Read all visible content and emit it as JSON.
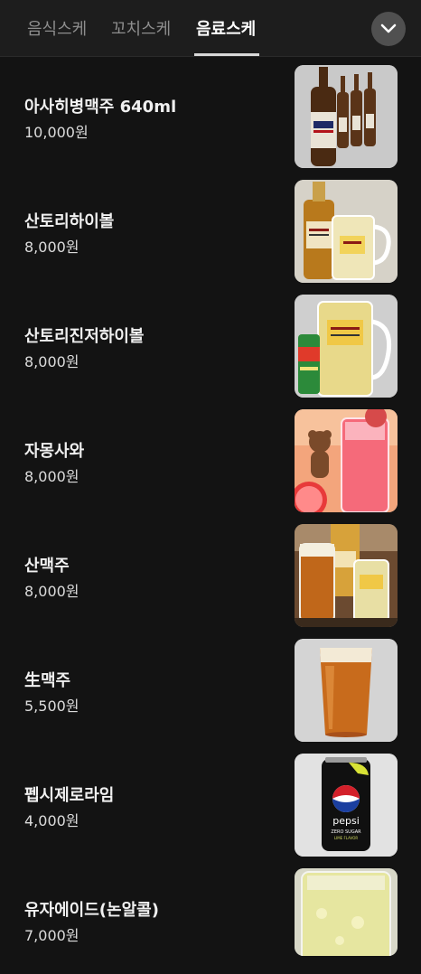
{
  "tabs": [
    {
      "label": "음식스케",
      "active": false
    },
    {
      "label": "꼬치스케",
      "active": false
    },
    {
      "label": "음료스케",
      "active": true
    }
  ],
  "expand_icon": "chevron-down-icon",
  "items": [
    {
      "name": "아사히병맥주 640ml",
      "price": "10,000원",
      "image": "asahi-bottles"
    },
    {
      "name": "산토리하이볼",
      "price": "8,000원",
      "image": "whisky-highball"
    },
    {
      "name": "산토리진저하이볼",
      "price": "8,000원",
      "image": "ginger-highball"
    },
    {
      "name": "자몽사와",
      "price": "8,000원",
      "image": "grapefruit-sour"
    },
    {
      "name": "산맥주",
      "price": "8,000원",
      "image": "beer-and-highball"
    },
    {
      "name": "生맥주",
      "price": "5,500원",
      "image": "draft-beer"
    },
    {
      "name": "펩시제로라임",
      "price": "4,000원",
      "image": "pepsi-can"
    },
    {
      "name": "유자에이드(논알콜)",
      "price": "7,000원",
      "image": "yuzu-ade"
    }
  ],
  "pepsi_can_text": [
    "pepsi",
    "ZERO SUGAR",
    "LIME FLAVOR"
  ],
  "colors": {
    "background": "#131313",
    "tabbar": "#1d1d1d",
    "active_tab": "#ffffff",
    "inactive_tab": "#8e8e8e"
  }
}
